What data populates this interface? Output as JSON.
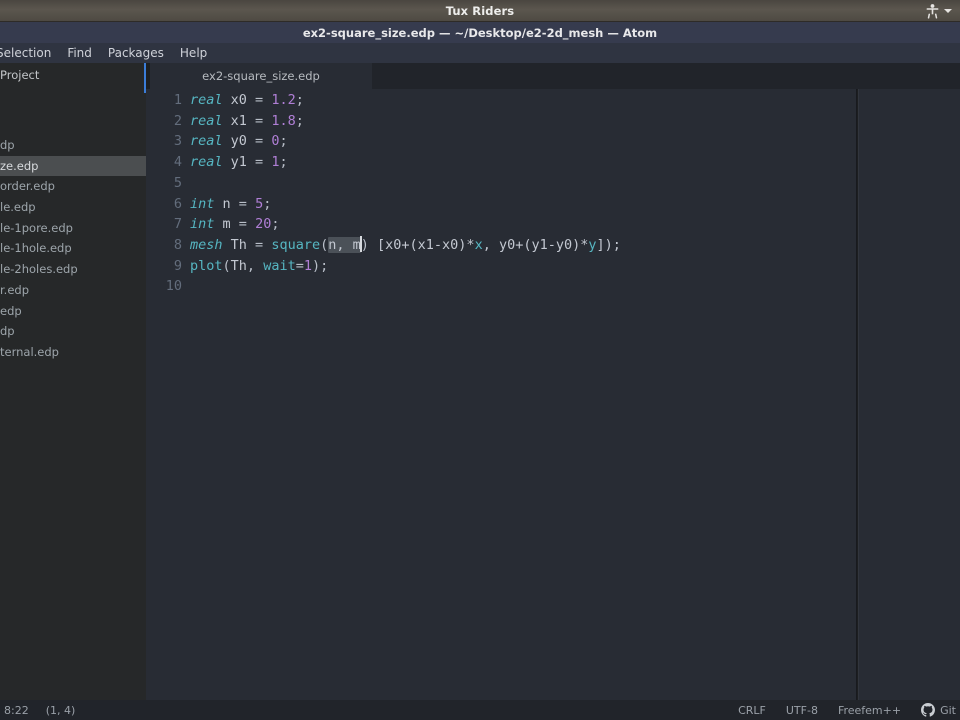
{
  "system_bar": {
    "title": "Tux Riders",
    "accessibility_icon": "accessibility-person-icon",
    "dropdown_icon": "chevron-down-icon"
  },
  "window": {
    "title": "ex2-square_size.edp — ~/Desktop/e2-2d_mesh — Atom"
  },
  "menubar": {
    "items": [
      {
        "label": "Selection"
      },
      {
        "label": "Find"
      },
      {
        "label": "Packages"
      },
      {
        "label": "Help"
      }
    ]
  },
  "sidebar": {
    "header": "Project",
    "items": [
      {
        "label": "dp",
        "selected": false
      },
      {
        "label": "ze.edp",
        "selected": true
      },
      {
        "label": "order.edp",
        "selected": false
      },
      {
        "label": "le.edp",
        "selected": false
      },
      {
        "label": "le-1pore.edp",
        "selected": false
      },
      {
        "label": "le-1hole.edp",
        "selected": false
      },
      {
        "label": "le-2holes.edp",
        "selected": false
      },
      {
        "label": "r.edp",
        "selected": false
      },
      {
        "label": "edp",
        "selected": false
      },
      {
        "label": "dp",
        "selected": false
      },
      {
        "label": "ternal.edp",
        "selected": false
      }
    ]
  },
  "tabs": [
    {
      "label": "ex2-square_size.edp",
      "active": true
    }
  ],
  "editor": {
    "line_numbers": [
      "1",
      "2",
      "3",
      "4",
      "5",
      "6",
      "7",
      "8",
      "9",
      "10"
    ],
    "lines": [
      {
        "n": 1,
        "text": "real x0 = 1.2;"
      },
      {
        "n": 2,
        "text": "real x1 = 1.8;"
      },
      {
        "n": 3,
        "text": "real y0 = 0;"
      },
      {
        "n": 4,
        "text": "real y1 = 1;"
      },
      {
        "n": 5,
        "text": ""
      },
      {
        "n": 6,
        "text": "int n = 5;"
      },
      {
        "n": 7,
        "text": "int m = 20;"
      },
      {
        "n": 8,
        "text": "mesh Th = square(n, m) [x0+(x1-x0)*x, y0+(y1-y0)*y]);"
      },
      {
        "n": 9,
        "text": "plot(Th, wait=1);"
      },
      {
        "n": 10,
        "text": ""
      }
    ],
    "selection_text": "n, m",
    "tokens": {
      "l1": {
        "kw": "real",
        "var": "x0",
        "eq": " = ",
        "num": "1.2",
        "end": ";"
      },
      "l2": {
        "kw": "real",
        "var": "x1",
        "eq": " = ",
        "num": "1.8",
        "end": ";"
      },
      "l3": {
        "kw": "real",
        "var": "y0",
        "eq": " = ",
        "num": "0",
        "end": ";"
      },
      "l4": {
        "kw": "real",
        "var": "y1",
        "eq": " = ",
        "num": "1",
        "end": ";"
      },
      "l6": {
        "kw": "int",
        "var": "n",
        "eq": " = ",
        "num": "5",
        "end": ";"
      },
      "l7": {
        "kw": "int",
        "var": "m",
        "eq": " = ",
        "num": "20",
        "end": ";"
      },
      "l8": {
        "kw": "mesh",
        "var": "Th",
        "eq": " = ",
        "fn": "square",
        "open": "(",
        "sel": "n, m",
        "close": ")",
        "expr_a": " [x0+(x1-x0)*",
        "px": "x",
        "expr_b": ", y0+(y1-y0)*",
        "py": "y",
        "expr_c": "]);"
      },
      "l9": {
        "fn": "plot",
        "open": "(",
        "var": "Th",
        "comma": ", ",
        "param": "wait",
        "eq": "=",
        "num": "1",
        "close": ");"
      }
    }
  },
  "statusbar": {
    "left": [
      {
        "label": "8:22",
        "name": "file-position"
      },
      {
        "label": "(1, 4)",
        "name": "cursor-position"
      }
    ],
    "right": [
      {
        "label": "CRLF",
        "name": "line-ending"
      },
      {
        "label": "UTF-8",
        "name": "encoding"
      },
      {
        "label": "Freefem++",
        "name": "grammar"
      }
    ],
    "git": {
      "label": "Git",
      "icon": "github-icon"
    }
  },
  "colors": {
    "system_bar": "#4e4a43",
    "title_bar": "#363b4e",
    "menu_bar": "#2f3441",
    "sidebar_bg": "#262829",
    "sidebar_selected": "#4b4e50",
    "editor_bg": "#282c34",
    "tab_bg": "#282c34",
    "status_bg": "#21242a",
    "accent_blue": "#3b7dd8",
    "syntax_keyword": "#56b6c2",
    "syntax_number": "#b07fd6",
    "syntax_variable": "#c3c8d1",
    "selection": "#4b5158"
  }
}
